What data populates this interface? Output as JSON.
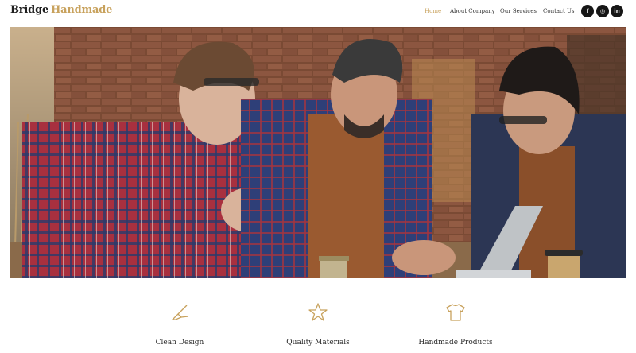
{
  "brand": {
    "name_dark": "Bridge",
    "name_accent": "Handmade",
    "accent_color": "#c8a25d"
  },
  "nav": {
    "items": [
      {
        "label": "Home",
        "active": true
      },
      {
        "label": "About Company",
        "active": false
      },
      {
        "label": "Our Services",
        "active": false
      },
      {
        "label": "Contact Us",
        "active": false
      }
    ]
  },
  "social": [
    {
      "icon": "facebook-icon",
      "glyph": "f"
    },
    {
      "icon": "instagram-icon",
      "glyph": "◎"
    },
    {
      "icon": "linkedin-icon",
      "glyph": "in"
    }
  ],
  "hero": {
    "image": "craftspeople-workshop-photo"
  },
  "features": [
    {
      "icon": "brush-icon",
      "label": "Clean Design"
    },
    {
      "icon": "star-icon",
      "label": "Quality Materials"
    },
    {
      "icon": "tshirt-icon",
      "label": "Handmade Products"
    }
  ]
}
